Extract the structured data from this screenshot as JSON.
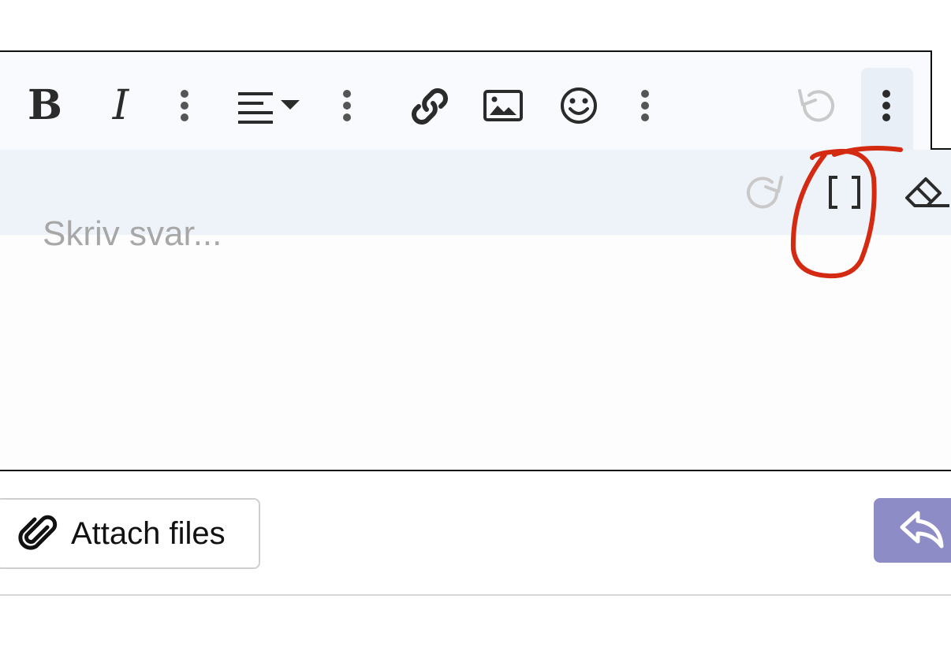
{
  "editor": {
    "placeholder": "Skriv svar..."
  },
  "toolbar": {
    "bold_label": "B",
    "italic_label": "I",
    "icons": [
      "bold-icon",
      "italic-icon",
      "vertical-dots-icon",
      "align-left-icon",
      "chevron-down-icon",
      "link-icon",
      "image-icon",
      "smiley-icon",
      "undo-icon",
      "redo-icon",
      "brackets-icon",
      "eraser-icon"
    ]
  },
  "footer": {
    "attach_label": "Attach files",
    "reply_icon": "reply-arrow-icon"
  },
  "colors": {
    "annotation": "#d42a12",
    "reply_button": "#8e8cc6",
    "toolbar_bg": "#f8fafd",
    "toolbar_row2_bg": "#eef3f9",
    "icon": "#2b2b2b",
    "icon_disabled": "#c9c9c9"
  }
}
